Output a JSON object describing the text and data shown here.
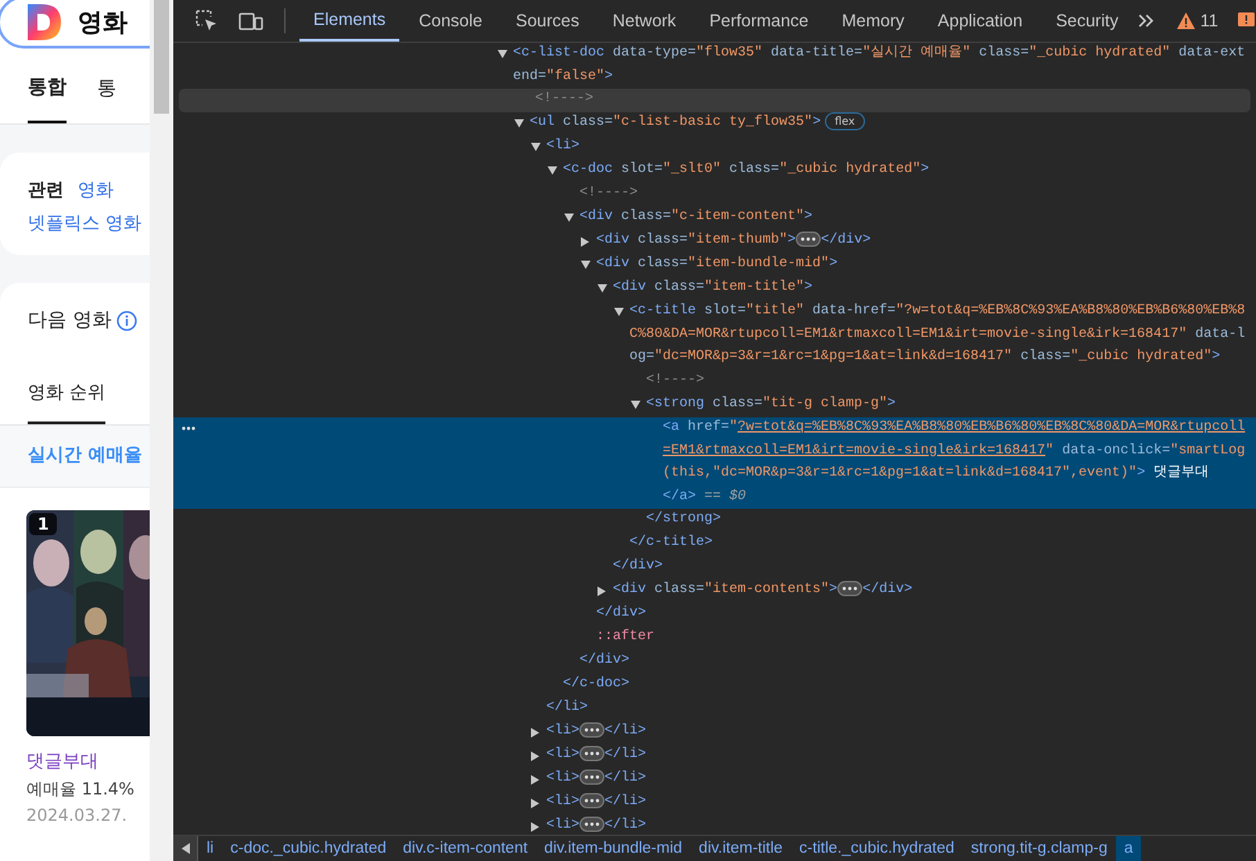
{
  "page": {
    "search": {
      "value": "영화"
    },
    "tabs": [
      {
        "label": "통합",
        "selected": true
      },
      {
        "label": "통",
        "selected": false
      }
    ],
    "related": {
      "label": "관련",
      "links": [
        "영화",
        "넷플릭스 영화"
      ]
    },
    "section": {
      "title": "다음 영화",
      "tabs": [
        {
          "label": "영화 순위",
          "selected": true
        }
      ],
      "subtab": "실시간 예매율",
      "movie": {
        "rank": "1",
        "title": "댓글부대",
        "rate": "예매율 11.4%",
        "date": "2024.03.27."
      }
    }
  },
  "devtools": {
    "tabs": [
      {
        "label": "Elements",
        "selected": true
      },
      {
        "label": "Console",
        "selected": false
      },
      {
        "label": "Sources",
        "selected": false
      },
      {
        "label": "Network",
        "selected": false
      },
      {
        "label": "Performance",
        "selected": false
      },
      {
        "label": "Memory",
        "selected": false
      },
      {
        "label": "Application",
        "selected": false
      },
      {
        "label": "Security",
        "selected": false
      }
    ],
    "warnings": "11",
    "selected_suffix": "== $0",
    "tree": [
      {
        "kind": "element",
        "expanded": true,
        "open": [
          {
            "kind": "tag",
            "text": "<c-list-doc"
          },
          {
            "kind": "attr",
            "text": " data-type="
          },
          {
            "kind": "value",
            "text": "\"flow35\""
          },
          {
            "kind": "attr",
            "text": " data-title="
          },
          {
            "kind": "value",
            "text": "\"실시간 예매율\""
          },
          {
            "kind": "attr",
            "text": " class="
          },
          {
            "kind": "value",
            "text": "\"_cubic hydrated\""
          },
          {
            "kind": "attr",
            "text": " data-extend="
          },
          {
            "kind": "value",
            "text": "\"false\""
          },
          {
            "kind": "tag",
            "text": ">"
          }
        ],
        "children": [
          {
            "kind": "leaf",
            "hovered": true,
            "open": [
              {
                "kind": "comment",
                "text": "<!---->"
              }
            ]
          },
          {
            "kind": "element",
            "expanded": true,
            "badge": "flex",
            "open": [
              {
                "kind": "tag",
                "text": "<ul"
              },
              {
                "kind": "attr",
                "text": " class="
              },
              {
                "kind": "value",
                "text": "\"c-list-basic ty_flow35\""
              },
              {
                "kind": "tag",
                "text": ">"
              }
            ],
            "children": [
              {
                "kind": "element",
                "expanded": true,
                "open": [
                  {
                    "kind": "tag",
                    "text": "<li>"
                  }
                ],
                "close": [
                  {
                    "kind": "tag",
                    "text": "</li>"
                  }
                ],
                "children": [
                  {
                    "kind": "element",
                    "expanded": true,
                    "open": [
                      {
                        "kind": "tag",
                        "text": "<c-doc"
                      },
                      {
                        "kind": "attr",
                        "text": " slot="
                      },
                      {
                        "kind": "value",
                        "text": "\"_slt0\""
                      },
                      {
                        "kind": "attr",
                        "text": " class="
                      },
                      {
                        "kind": "value",
                        "text": "\"_cubic hydrated\""
                      },
                      {
                        "kind": "tag",
                        "text": ">"
                      }
                    ],
                    "close": [
                      {
                        "kind": "tag",
                        "text": "</c-doc>"
                      }
                    ],
                    "children": [
                      {
                        "kind": "leaf",
                        "open": [
                          {
                            "kind": "comment",
                            "text": "<!---->"
                          }
                        ]
                      },
                      {
                        "kind": "element",
                        "expanded": true,
                        "open": [
                          {
                            "kind": "tag",
                            "text": "<div"
                          },
                          {
                            "kind": "attr",
                            "text": " class="
                          },
                          {
                            "kind": "value",
                            "text": "\"c-item-content\""
                          },
                          {
                            "kind": "tag",
                            "text": ">"
                          }
                        ],
                        "close": [
                          {
                            "kind": "tag",
                            "text": "</div>"
                          }
                        ],
                        "children": [
                          {
                            "kind": "element",
                            "expanded": false,
                            "open": [
                              {
                                "kind": "tag",
                                "text": "<div"
                              },
                              {
                                "kind": "attr",
                                "text": " class="
                              },
                              {
                                "kind": "value",
                                "text": "\"item-thumb\""
                              },
                              {
                                "kind": "tag",
                                "text": ">"
                              }
                            ],
                            "close": [
                              {
                                "kind": "tag",
                                "text": "</div>"
                              }
                            ]
                          },
                          {
                            "kind": "element",
                            "expanded": true,
                            "open": [
                              {
                                "kind": "tag",
                                "text": "<div"
                              },
                              {
                                "kind": "attr",
                                "text": " class="
                              },
                              {
                                "kind": "value",
                                "text": "\"item-bundle-mid\""
                              },
                              {
                                "kind": "tag",
                                "text": ">"
                              }
                            ],
                            "close": [
                              {
                                "kind": "tag",
                                "text": "</div>"
                              }
                            ],
                            "children": [
                              {
                                "kind": "element",
                                "expanded": true,
                                "open": [
                                  {
                                    "kind": "tag",
                                    "text": "<div"
                                  },
                                  {
                                    "kind": "attr",
                                    "text": " class="
                                  },
                                  {
                                    "kind": "value",
                                    "text": "\"item-title\""
                                  },
                                  {
                                    "kind": "tag",
                                    "text": ">"
                                  }
                                ],
                                "close": [
                                  {
                                    "kind": "tag",
                                    "text": "</div>"
                                  }
                                ],
                                "children": [
                                  {
                                    "kind": "element",
                                    "expanded": true,
                                    "open": [
                                      {
                                        "kind": "tag",
                                        "text": "<c-title"
                                      },
                                      {
                                        "kind": "attr",
                                        "text": " slot="
                                      },
                                      {
                                        "kind": "value",
                                        "text": "\"title\""
                                      },
                                      {
                                        "kind": "attr",
                                        "text": " data-href="
                                      },
                                      {
                                        "kind": "value",
                                        "text": "\"?w=tot&q=%EB%8C%93%EA%B8%80%EB%B6%80%EB%8C%80&DA=MOR&rtupcoll=EM1&rtmaxcoll=EM1&irt=movie-single&irk=168417\""
                                      },
                                      {
                                        "kind": "attr",
                                        "text": " data-log="
                                      },
                                      {
                                        "kind": "value",
                                        "text": "\"dc=MOR&p=3&r=1&rc=1&pg=1&at=link&d=168417\""
                                      },
                                      {
                                        "kind": "attr",
                                        "text": " class="
                                      },
                                      {
                                        "kind": "value",
                                        "text": "\"_cubic hydrated\""
                                      },
                                      {
                                        "kind": "tag",
                                        "text": ">"
                                      }
                                    ],
                                    "close": [
                                      {
                                        "kind": "tag",
                                        "text": "</c-title>"
                                      }
                                    ],
                                    "children": [
                                      {
                                        "kind": "leaf",
                                        "open": [
                                          {
                                            "kind": "comment",
                                            "text": "<!---->"
                                          }
                                        ]
                                      },
                                      {
                                        "kind": "element",
                                        "expanded": true,
                                        "open": [
                                          {
                                            "kind": "tag",
                                            "text": "<strong"
                                          },
                                          {
                                            "kind": "attr",
                                            "text": " class="
                                          },
                                          {
                                            "kind": "value",
                                            "text": "\"tit-g clamp-g\""
                                          },
                                          {
                                            "kind": "tag",
                                            "text": ">"
                                          }
                                        ],
                                        "close": [
                                          {
                                            "kind": "tag",
                                            "text": "</strong>"
                                          }
                                        ],
                                        "children": [
                                          {
                                            "kind": "inline",
                                            "selected": true,
                                            "open": [
                                              {
                                                "kind": "tag",
                                                "text": "<a"
                                              },
                                              {
                                                "kind": "attr",
                                                "text": " href="
                                              },
                                              {
                                                "kind": "value",
                                                "text": "\""
                                              },
                                              {
                                                "kind": "link",
                                                "text": "?w=tot&q=%EB%8C%93%EA%B8%80%EB%B6%80%EB%8C%80&DA=MOR&rtupcoll=EM1&rtmaxcoll=EM1&irt=movie-single&irk=168417"
                                              },
                                              {
                                                "kind": "value",
                                                "text": "\""
                                              },
                                              {
                                                "kind": "attr",
                                                "text": " data-onclick="
                                              },
                                              {
                                                "kind": "value",
                                                "text": "\"smartLog(this,\"dc=MOR&p=3&r=1&rc=1&pg=1&at=link&d=168417\",event)\""
                                              },
                                              {
                                                "kind": "tag",
                                                "text": ">"
                                              },
                                              {
                                                "kind": "text",
                                                "text": " 댓글부대"
                                              }
                                            ],
                                            "close": [
                                              {
                                                "kind": "tag",
                                                "text": "</a>"
                                              }
                                            ]
                                          }
                                        ]
                                      }
                                    ]
                                  }
                                ]
                              },
                              {
                                "kind": "element",
                                "expanded": false,
                                "open": [
                                  {
                                    "kind": "tag",
                                    "text": "<div"
                                  },
                                  {
                                    "kind": "attr",
                                    "text": " class="
                                  },
                                  {
                                    "kind": "value",
                                    "text": "\"item-contents\""
                                  },
                                  {
                                    "kind": "tag",
                                    "text": ">"
                                  }
                                ],
                                "close": [
                                  {
                                    "kind": "tag",
                                    "text": "</div>"
                                  }
                                ]
                              }
                            ]
                          },
                          {
                            "kind": "leaf",
                            "open": [
                              {
                                "kind": "pseudo",
                                "text": "::after"
                              }
                            ]
                          }
                        ]
                      }
                    ]
                  }
                ]
              },
              {
                "kind": "element",
                "expanded": false,
                "open": [
                  {
                    "kind": "tag",
                    "text": "<li>"
                  }
                ],
                "close": [
                  {
                    "kind": "tag",
                    "text": "</li>"
                  }
                ]
              },
              {
                "kind": "element",
                "expanded": false,
                "open": [
                  {
                    "kind": "tag",
                    "text": "<li>"
                  }
                ],
                "close": [
                  {
                    "kind": "tag",
                    "text": "</li>"
                  }
                ]
              },
              {
                "kind": "element",
                "expanded": false,
                "open": [
                  {
                    "kind": "tag",
                    "text": "<li>"
                  }
                ],
                "close": [
                  {
                    "kind": "tag",
                    "text": "</li>"
                  }
                ]
              },
              {
                "kind": "element",
                "expanded": false,
                "open": [
                  {
                    "kind": "tag",
                    "text": "<li>"
                  }
                ],
                "close": [
                  {
                    "kind": "tag",
                    "text": "</li>"
                  }
                ]
              },
              {
                "kind": "element",
                "expanded": false,
                "open": [
                  {
                    "kind": "tag",
                    "text": "<li>"
                  }
                ],
                "close": [
                  {
                    "kind": "tag",
                    "text": "</li>"
                  }
                ]
              }
            ]
          }
        ]
      }
    ],
    "breadcrumbs": [
      {
        "label": "li",
        "selected": false
      },
      {
        "label": "c-doc._cubic.hydrated",
        "selected": false
      },
      {
        "label": "div.c-item-content",
        "selected": false
      },
      {
        "label": "div.item-bundle-mid",
        "selected": false
      },
      {
        "label": "div.item-title",
        "selected": false
      },
      {
        "label": "c-title._cubic.hydrated",
        "selected": false
      },
      {
        "label": "strong.tit-g.clamp-g",
        "selected": false
      },
      {
        "label": "a",
        "selected": true
      }
    ]
  }
}
